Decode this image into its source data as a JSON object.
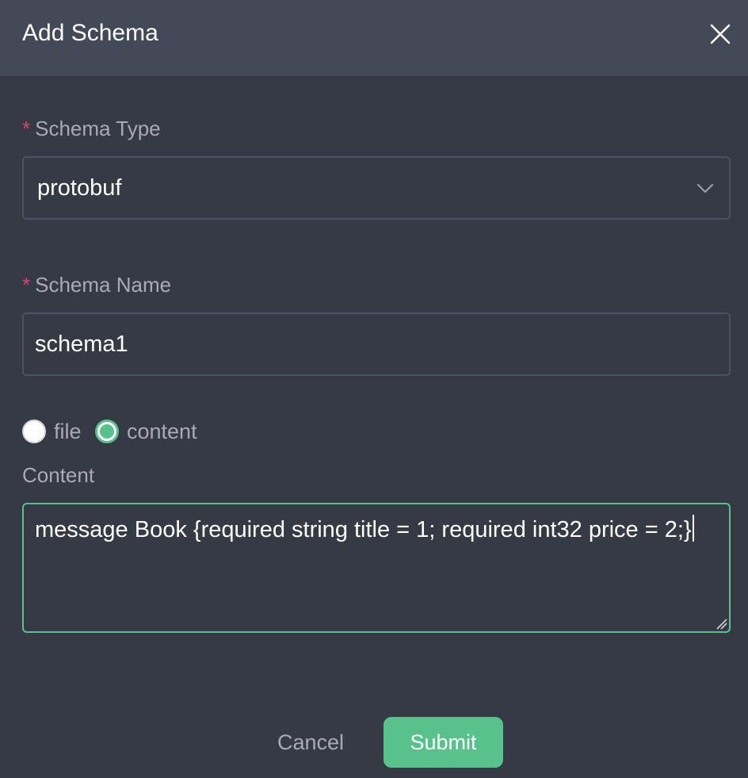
{
  "dialog": {
    "title": "Add Schema",
    "close_icon": "close-icon"
  },
  "schema_type": {
    "required_mark": "*",
    "label": "Schema Type",
    "selected_value": "protobuf",
    "dropdown_icon": "chevron-down-icon"
  },
  "schema_name": {
    "required_mark": "*",
    "label": "Schema Name",
    "value": "schema1"
  },
  "source_mode": {
    "options": [
      {
        "label": "file",
        "selected": false
      },
      {
        "label": "content",
        "selected": true
      }
    ]
  },
  "content": {
    "label": "Content",
    "value": "message Book {required string title = 1; required int32 price = 2;}"
  },
  "footer": {
    "cancel_label": "Cancel",
    "submit_label": "Submit"
  },
  "colors": {
    "accent": "#58c18c",
    "required": "#d9466a",
    "background": "#363a44",
    "header": "#434957"
  }
}
